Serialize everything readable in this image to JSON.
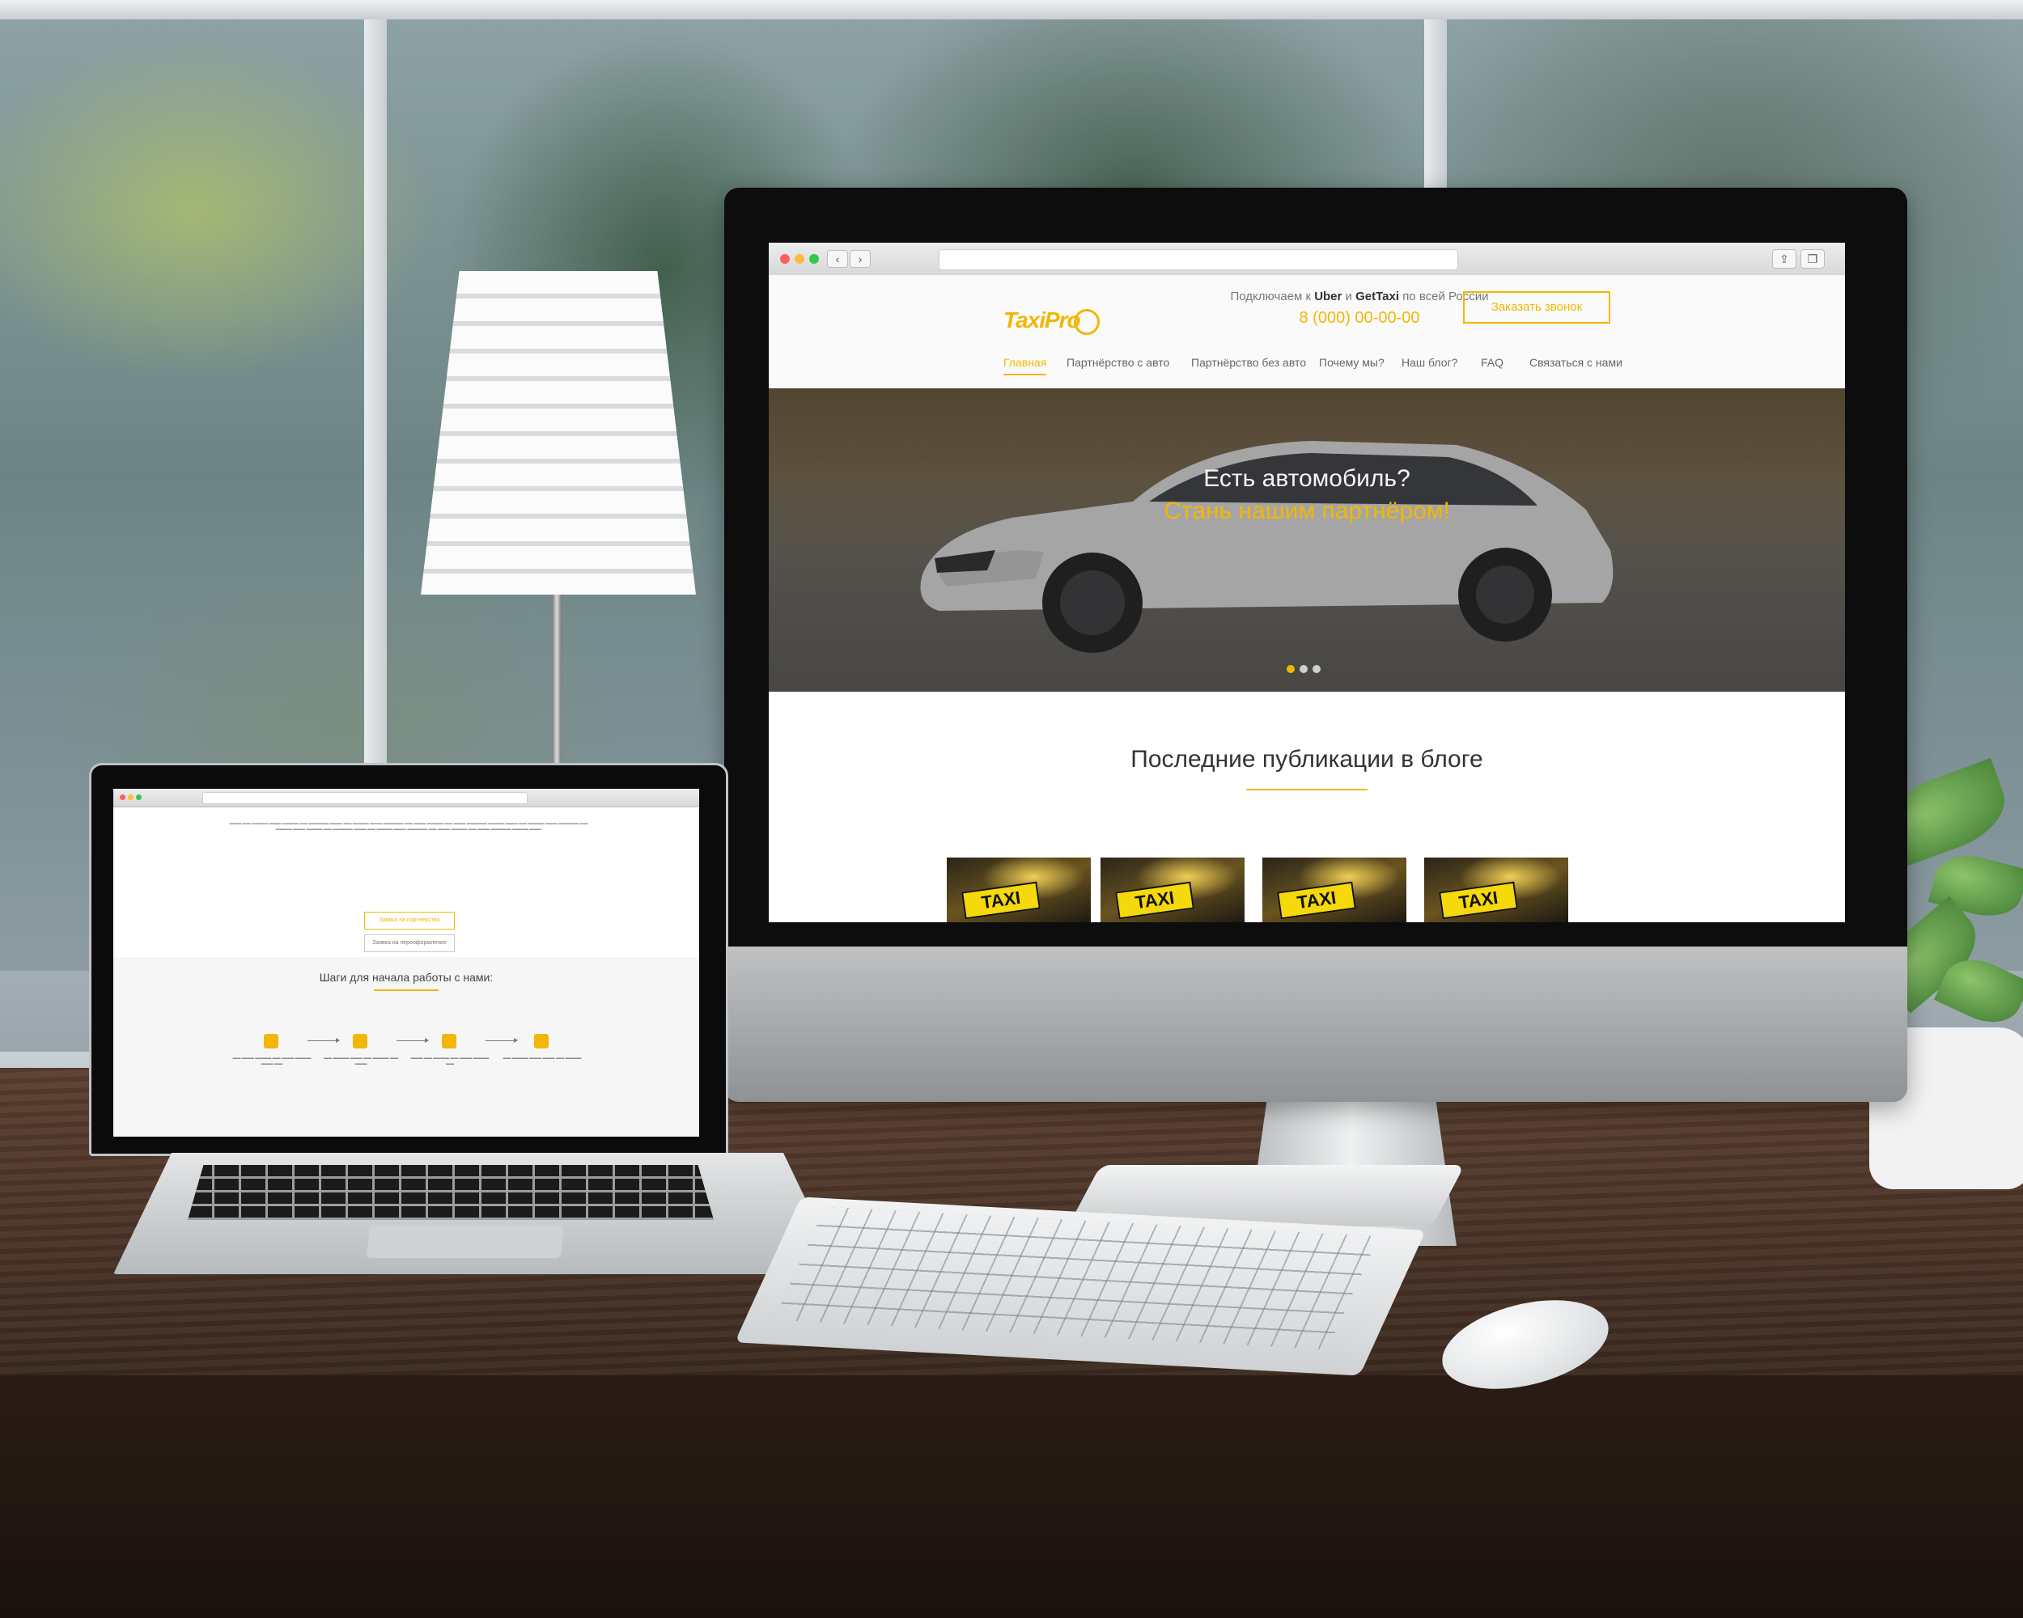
{
  "imac_site": {
    "logo_text": "TaxiPro",
    "tagline_prefix": "Подключаем к",
    "tagline_uber": "Uber",
    "tagline_and": "и",
    "tagline_gettaxi": "GetTaxi",
    "tagline_suffix": "по всей России",
    "phone": "8 (000) 00-00-00",
    "callback_button": "Заказать звонок",
    "menu": [
      {
        "label": "Главная",
        "active": true
      },
      {
        "label": "Партнёрство с авто",
        "active": false
      },
      {
        "label": "Партнёрство без авто",
        "active": false
      },
      {
        "label": "Почему мы?",
        "active": false
      },
      {
        "label": "Наш блог?",
        "active": false
      },
      {
        "label": "FAQ",
        "active": false
      },
      {
        "label": "Связаться с нами",
        "active": false
      }
    ],
    "hero_line1": "Есть автомобиль?",
    "hero_line2": "Стань нашим партнёром!",
    "slider_active_index": 0,
    "blog_section_title": "Последние публикации в блоге",
    "blog_thumb_label": "TAXI"
  },
  "laptop_site": {
    "button_primary": "Заявка на партнёрство",
    "button_secondary": "Заявка на переоформление",
    "steps_title": "Шаги для начала работы с нами:"
  },
  "colors": {
    "accent": "#f2b705",
    "text_dark": "#333333",
    "text_muted": "#777777"
  }
}
